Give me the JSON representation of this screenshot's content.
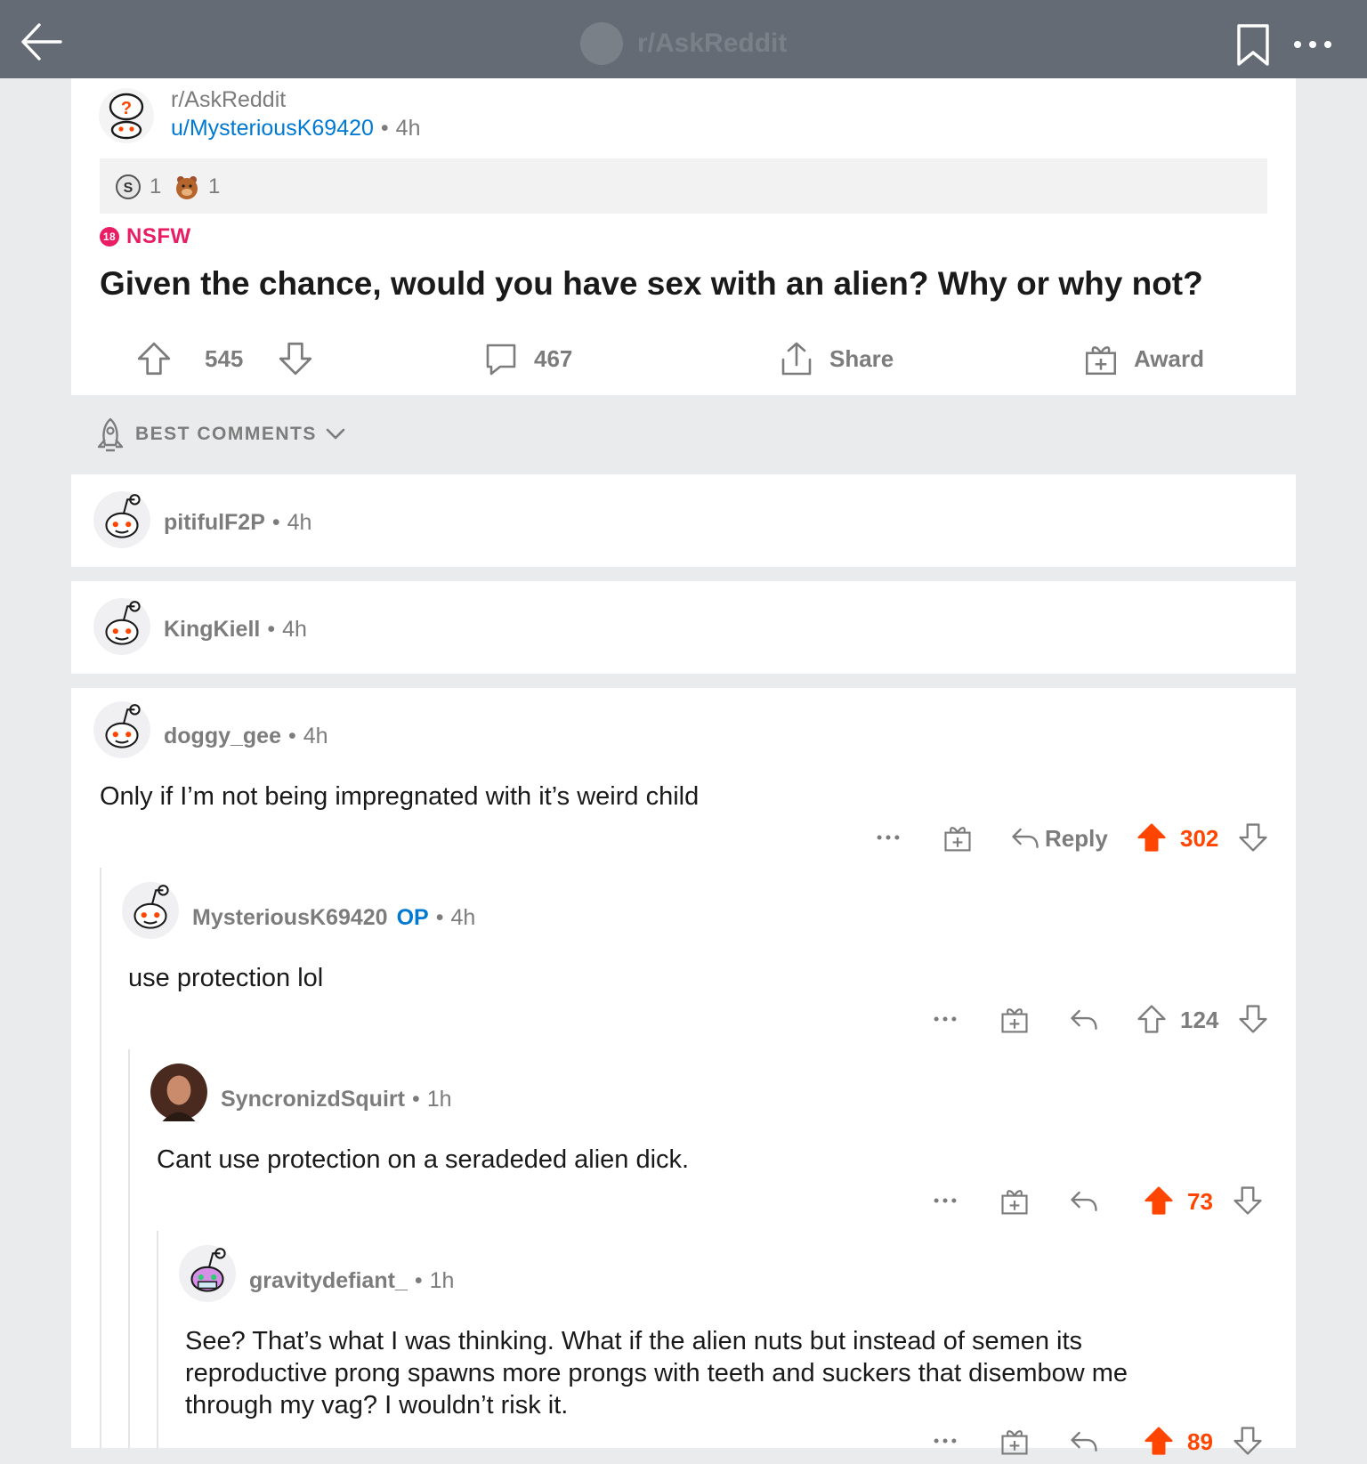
{
  "topbar": {
    "subreddit": "r/AskReddit"
  },
  "post": {
    "subreddit": "r/AskReddit",
    "author": "u/MysteriousK69420",
    "age": "4h",
    "awards": [
      {
        "icon": "silver-award-icon",
        "count": "1"
      },
      {
        "icon": "bear-award-icon",
        "count": "1"
      }
    ],
    "nsfw_badge": "18",
    "nsfw_label": "NSFW",
    "title": "Given the chance, would you have sex with an alien? Why or why not?",
    "upvotes": "545",
    "comments": "467",
    "share_label": "Share",
    "award_label": "Award"
  },
  "sort": {
    "label": "BEST COMMENTS"
  },
  "comments": [
    {
      "author": "pitifulF2P",
      "age": "4h",
      "collapsed": true
    },
    {
      "author": "KingKiell",
      "age": "4h",
      "collapsed": true
    },
    {
      "author": "doggy_gee",
      "age": "4h",
      "body": "Only if I’m not being impregnated with it’s weird child",
      "reply_label": "Reply",
      "votes": "302",
      "upvoted": true
    },
    {
      "author": "MysteriousK69420",
      "op_label": "OP",
      "age": "4h",
      "body": "use protection lol",
      "votes": "124",
      "upvoted": false
    },
    {
      "author": "SyncronizdSquirt",
      "age": "1h",
      "body": "Cant use protection on a seradeded alien dick.",
      "votes": "73",
      "upvoted": true
    },
    {
      "author": "gravitydefiant_",
      "age": "1h",
      "body": "See? That’s what I was thinking. What if the alien nuts but instead of semen its reproductive prong spawns more prongs with teeth and suckers that disembow me through my vag? I wouldn’t risk it.",
      "votes": "89",
      "upvoted": true
    }
  ],
  "colors": {
    "topbar": "#646b75",
    "upvote": "#ff4500",
    "link": "#0079d3",
    "nsfw": "#e91d63"
  }
}
